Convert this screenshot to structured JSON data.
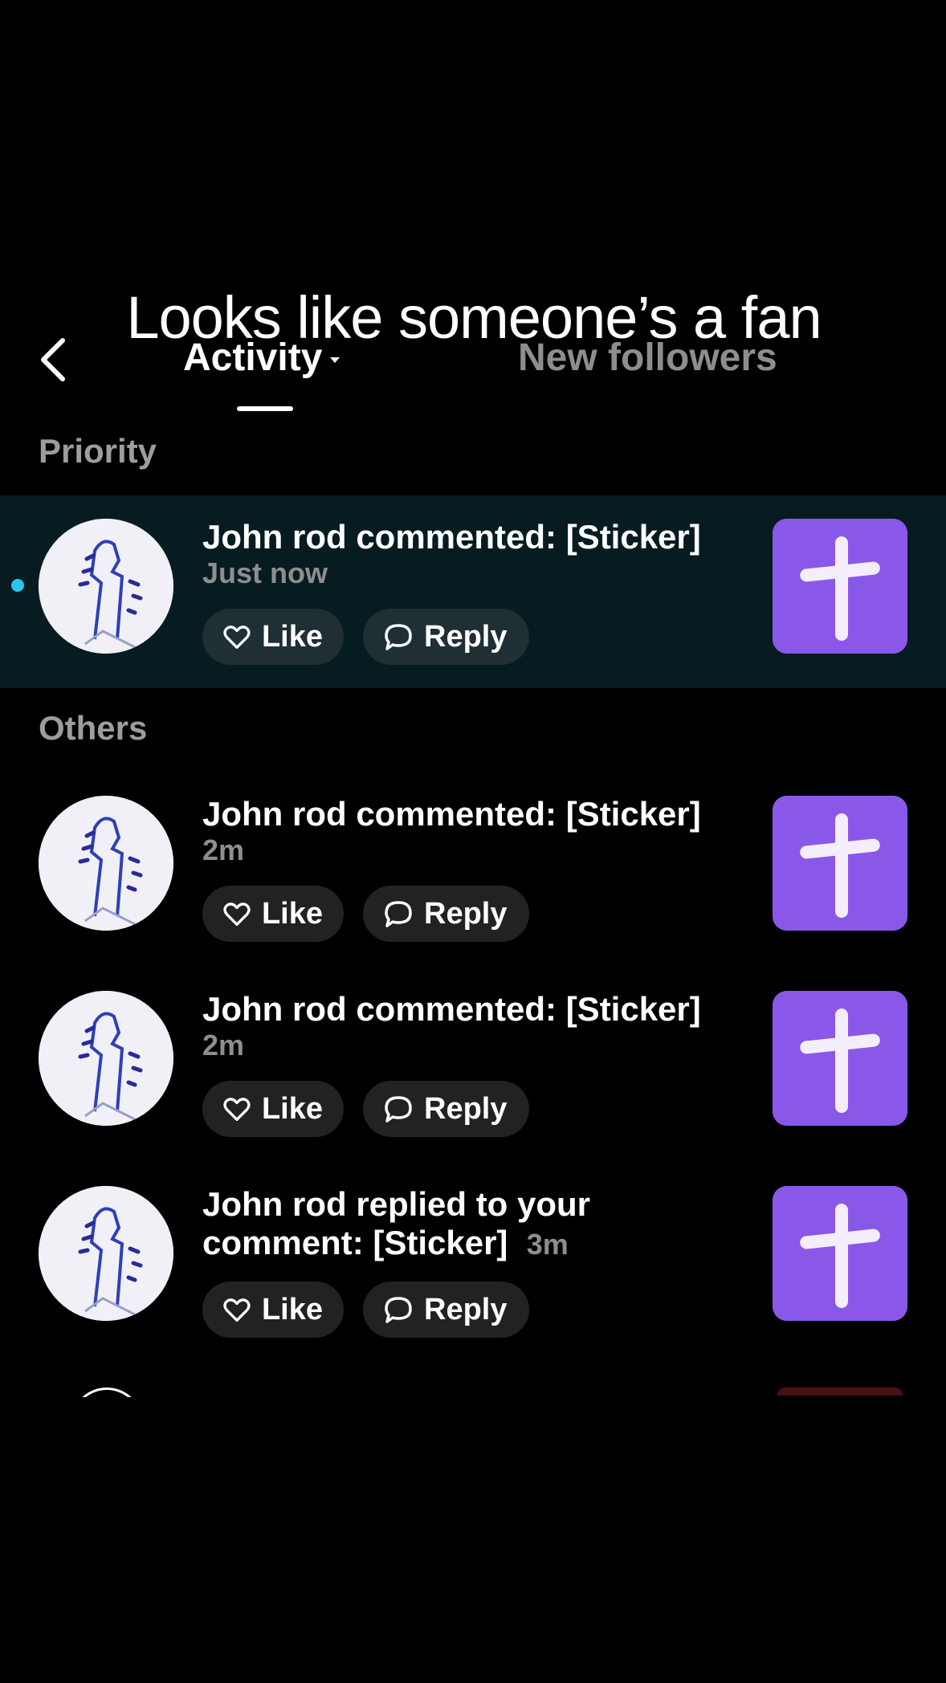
{
  "overlay": {
    "caption": "Looks like someone’s a fan"
  },
  "header": {
    "back_icon": "chevron-left-icon",
    "tabs": [
      {
        "label": "Activity",
        "active": true,
        "has_dropdown": true
      },
      {
        "label": "New followers",
        "active": false
      }
    ]
  },
  "sections": {
    "priority_label": "Priority",
    "others_label": "Others"
  },
  "notifications": [
    {
      "text": "John rod commented: [Sticker]",
      "time": "Just now",
      "unread": true,
      "like_label": "Like",
      "reply_label": "Reply"
    },
    {
      "text": "John rod commented: [Sticker]",
      "time": "2m",
      "unread": false,
      "like_label": "Like",
      "reply_label": "Reply"
    },
    {
      "text": "John rod commented: [Sticker]",
      "time": "2m",
      "unread": false,
      "like_label": "Like",
      "reply_label": "Reply"
    },
    {
      "text": "John rod replied to your comment: [Sticker]",
      "time": "3m",
      "unread": false,
      "like_label": "Like",
      "reply_label": "Reply"
    }
  ],
  "colors": {
    "background": "#000000",
    "unread_row": "#061c21",
    "unread_dot": "#29c5ef",
    "thumbnail": "#8a58e8",
    "muted_text": "#8e8e8e"
  }
}
